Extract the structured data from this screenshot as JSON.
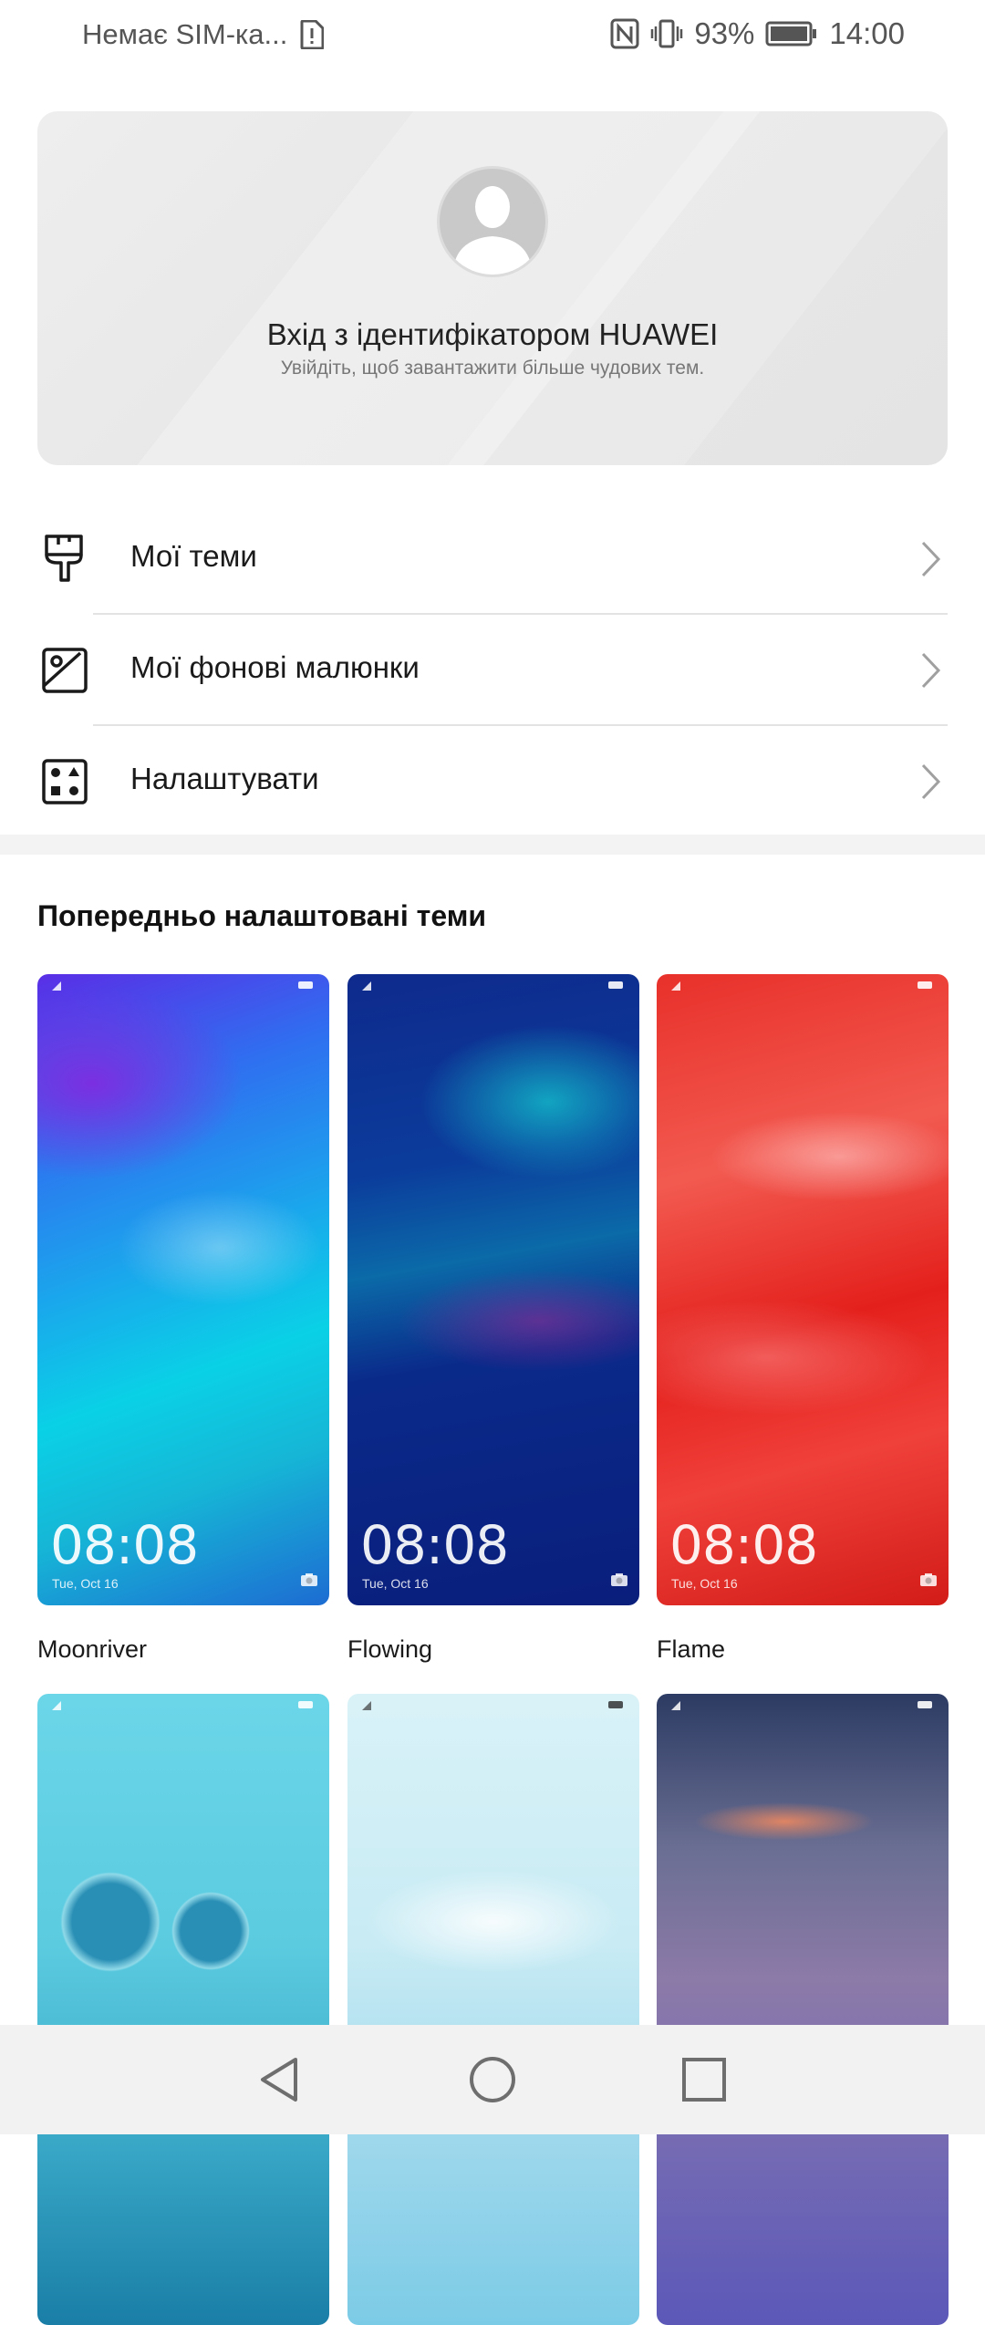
{
  "status_bar": {
    "carrier": "Немає SIM-ка...",
    "battery_percent": "93%",
    "time": "14:00"
  },
  "login_card": {
    "title": "Вхід з ідентифікатором HUAWEI",
    "subtitle": "Увійдіть, щоб завантажити більше чудових тем."
  },
  "menu": [
    {
      "label": "Мої теми",
      "icon": "brush-icon"
    },
    {
      "label": "Мої фонові малюнки",
      "icon": "image-icon"
    },
    {
      "label": "Налаштувати",
      "icon": "customize-grid-icon"
    }
  ],
  "section_title": "Попередньо налаштовані теми",
  "preview": {
    "clock": "08:08",
    "date": "Tue, Oct 16"
  },
  "themes": [
    {
      "name": "Moonriver"
    },
    {
      "name": "Flowing"
    },
    {
      "name": "Flame"
    },
    {
      "name": ""
    },
    {
      "name": ""
    },
    {
      "name": ""
    }
  ],
  "nav_bar": {
    "back_icon": "back-triangle-icon",
    "home_icon": "home-circle-icon",
    "recents_icon": "recents-square-icon"
  }
}
